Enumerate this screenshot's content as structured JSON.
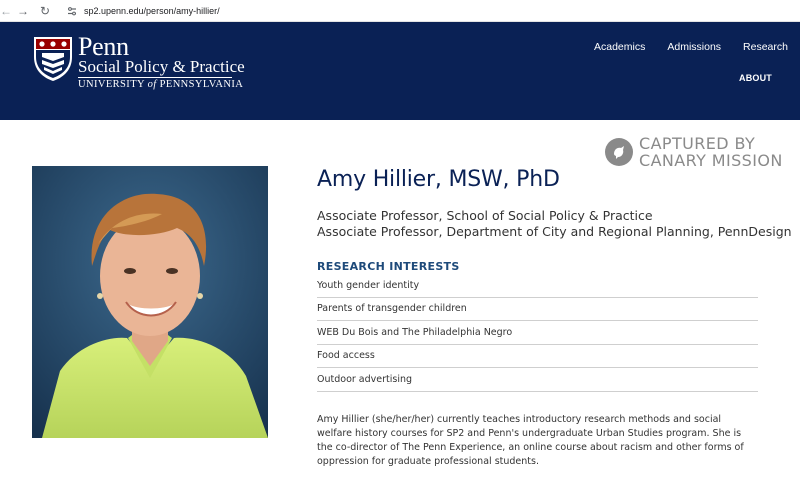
{
  "browser": {
    "url": "sp2.upenn.edu/person/amy-hillier/"
  },
  "header": {
    "logo": {
      "penn": "Penn",
      "school": "Social Policy & Practice",
      "university_pre": "University ",
      "university_of": "of",
      "university_post": " Pennsylvania"
    },
    "nav": [
      "Academics",
      "Admissions",
      "Research"
    ],
    "about": "ABOUT",
    "bg_color": "#0a2155"
  },
  "watermark": {
    "line1": "CAPTURED BY",
    "line2": "CANARY MISSION"
  },
  "profile": {
    "name": "Amy Hillier, MSW, PhD",
    "titles": [
      "Associate Professor, School of Social Policy & Practice",
      "Associate Professor, Department of City and Regional Planning, PennDesign"
    ],
    "research_heading": "RESEARCH INTERESTS",
    "research_interests": [
      "Youth gender identity",
      "Parents of transgender children",
      "WEB Du Bois and The Philadelphia Negro",
      "Food access",
      "Outdoor advertising"
    ],
    "bio": "Amy Hillier (she/her/her) currently teaches introductory research methods and social welfare history courses for SP2 and Penn's undergraduate Urban Studies program. She is the co-director of The Penn Experience, an online course about racism and other forms of oppression for graduate professional students."
  },
  "icons": {
    "back": "back-arrow-icon",
    "forward": "forward-arrow-icon",
    "reload": "reload-icon",
    "site": "site-settings-icon",
    "shield": "penn-shield-icon",
    "canary": "canary-bird-icon"
  }
}
